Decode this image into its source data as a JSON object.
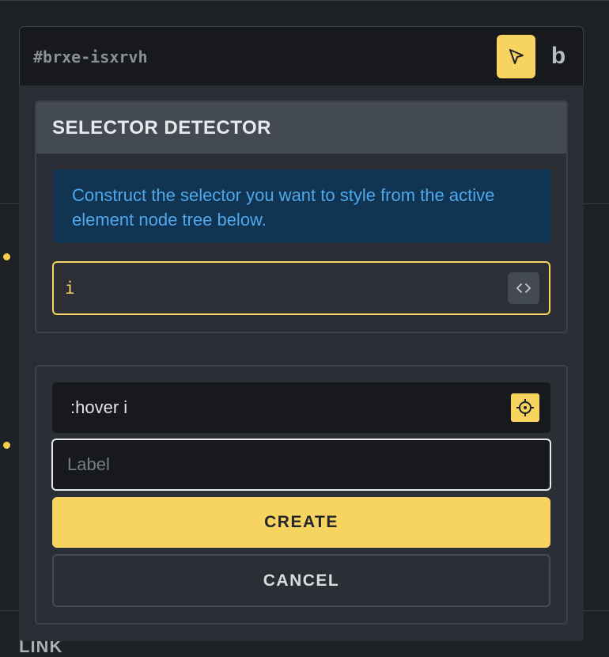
{
  "top_bar": {
    "selector_id": "#brxe-isxrvh",
    "b_label": "b"
  },
  "detector": {
    "title": "SELECTOR DETECTOR",
    "info": "Construct the selector you want to style from the active element node tree below.",
    "node_value": "i"
  },
  "create_panel": {
    "selector_value": ":hover i",
    "label_placeholder": "Label",
    "label_value": "",
    "create_label": "CREATE",
    "cancel_label": "CANCEL"
  },
  "background": {
    "section_label": "LINK"
  },
  "colors": {
    "accent": "#f7d460",
    "info_bg": "#103452",
    "info_text": "#4ea9ec",
    "panel_bg": "#2a2e34"
  },
  "icons": {
    "pick": "cursor-pointer-icon",
    "code": "code-brackets-icon",
    "target": "crosshair-icon"
  }
}
